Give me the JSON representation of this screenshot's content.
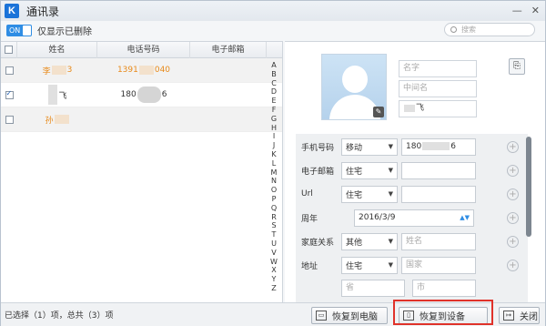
{
  "window": {
    "title": "通讯录",
    "logo": "K"
  },
  "toolbar": {
    "toggle_label": "ON",
    "filter_label": "仅显示已删除",
    "search_placeholder": "搜索"
  },
  "table": {
    "headers": [
      "姓名",
      "电话号码",
      "电子邮箱"
    ],
    "rows": [
      {
        "name": "李",
        "name_suffix": "3",
        "phone": "1391",
        "phone_suffix": "040",
        "email": "",
        "checked": false,
        "name_color": "orange"
      },
      {
        "name": "",
        "name_suffix": "飞",
        "phone": "180",
        "phone_suffix": "6",
        "email": "",
        "checked": true,
        "name_color": "dark"
      },
      {
        "name": "孙",
        "name_suffix": "",
        "phone": "",
        "phone_suffix": "",
        "email": "",
        "checked": false,
        "name_color": "orange"
      }
    ],
    "alphabet": [
      "A",
      "B",
      "C",
      "D",
      "E",
      "F",
      "G",
      "H",
      "I",
      "J",
      "K",
      "L",
      "M",
      "N",
      "O",
      "P",
      "Q",
      "R",
      "S",
      "T",
      "U",
      "V",
      "W",
      "X",
      "Y",
      "Z"
    ]
  },
  "detail": {
    "first_name_placeholder": "名字",
    "middle_name_placeholder": "中间名",
    "last_name_value": "飞",
    "fields": [
      {
        "label": "手机号码",
        "select": "移动",
        "value": "180",
        "value_suffix": "6"
      },
      {
        "label": "电子邮箱",
        "select": "住宅",
        "value": ""
      },
      {
        "label": "Url",
        "select": "住宅",
        "value": ""
      },
      {
        "label": "周年",
        "value": "2016/3/9"
      },
      {
        "label": "家庭关系",
        "select": "其他",
        "placeholder": "姓名"
      },
      {
        "label": "地址",
        "select": "住宅",
        "placeholder": "国家"
      }
    ],
    "address_more": [
      "省",
      "市"
    ]
  },
  "status": {
    "text": "已选择（1）项，总共（3）项"
  },
  "buttons": {
    "restore_pc": "恢复到电脑",
    "restore_device": "恢复到设备",
    "close": "关闭"
  },
  "colors": {
    "accent": "#2f8de4",
    "highlight": "#e0322a",
    "orange_text": "#e88a1a"
  },
  "icons": {
    "toggle": "toggle-switch",
    "search": "search-icon",
    "export": "export-icon",
    "edit": "pencil-icon",
    "add": "plus-circle-icon"
  }
}
